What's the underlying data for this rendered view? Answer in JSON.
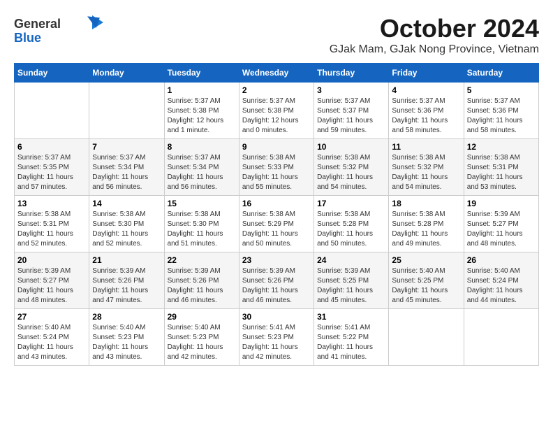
{
  "header": {
    "logo": {
      "general": "General",
      "blue": "Blue"
    },
    "month": "October 2024",
    "location": "GJak Mam, GJak Nong Province, Vietnam"
  },
  "weekdays": [
    "Sunday",
    "Monday",
    "Tuesday",
    "Wednesday",
    "Thursday",
    "Friday",
    "Saturday"
  ],
  "weeks": [
    [
      {
        "day": "",
        "sunrise": "",
        "sunset": "",
        "daylight": ""
      },
      {
        "day": "",
        "sunrise": "",
        "sunset": "",
        "daylight": ""
      },
      {
        "day": "1",
        "sunrise": "Sunrise: 5:37 AM",
        "sunset": "Sunset: 5:38 PM",
        "daylight": "Daylight: 12 hours and 1 minute."
      },
      {
        "day": "2",
        "sunrise": "Sunrise: 5:37 AM",
        "sunset": "Sunset: 5:38 PM",
        "daylight": "Daylight: 12 hours and 0 minutes."
      },
      {
        "day": "3",
        "sunrise": "Sunrise: 5:37 AM",
        "sunset": "Sunset: 5:37 PM",
        "daylight": "Daylight: 11 hours and 59 minutes."
      },
      {
        "day": "4",
        "sunrise": "Sunrise: 5:37 AM",
        "sunset": "Sunset: 5:36 PM",
        "daylight": "Daylight: 11 hours and 58 minutes."
      },
      {
        "day": "5",
        "sunrise": "Sunrise: 5:37 AM",
        "sunset": "Sunset: 5:36 PM",
        "daylight": "Daylight: 11 hours and 58 minutes."
      }
    ],
    [
      {
        "day": "6",
        "sunrise": "Sunrise: 5:37 AM",
        "sunset": "Sunset: 5:35 PM",
        "daylight": "Daylight: 11 hours and 57 minutes."
      },
      {
        "day": "7",
        "sunrise": "Sunrise: 5:37 AM",
        "sunset": "Sunset: 5:34 PM",
        "daylight": "Daylight: 11 hours and 56 minutes."
      },
      {
        "day": "8",
        "sunrise": "Sunrise: 5:37 AM",
        "sunset": "Sunset: 5:34 PM",
        "daylight": "Daylight: 11 hours and 56 minutes."
      },
      {
        "day": "9",
        "sunrise": "Sunrise: 5:38 AM",
        "sunset": "Sunset: 5:33 PM",
        "daylight": "Daylight: 11 hours and 55 minutes."
      },
      {
        "day": "10",
        "sunrise": "Sunrise: 5:38 AM",
        "sunset": "Sunset: 5:32 PM",
        "daylight": "Daylight: 11 hours and 54 minutes."
      },
      {
        "day": "11",
        "sunrise": "Sunrise: 5:38 AM",
        "sunset": "Sunset: 5:32 PM",
        "daylight": "Daylight: 11 hours and 54 minutes."
      },
      {
        "day": "12",
        "sunrise": "Sunrise: 5:38 AM",
        "sunset": "Sunset: 5:31 PM",
        "daylight": "Daylight: 11 hours and 53 minutes."
      }
    ],
    [
      {
        "day": "13",
        "sunrise": "Sunrise: 5:38 AM",
        "sunset": "Sunset: 5:31 PM",
        "daylight": "Daylight: 11 hours and 52 minutes."
      },
      {
        "day": "14",
        "sunrise": "Sunrise: 5:38 AM",
        "sunset": "Sunset: 5:30 PM",
        "daylight": "Daylight: 11 hours and 52 minutes."
      },
      {
        "day": "15",
        "sunrise": "Sunrise: 5:38 AM",
        "sunset": "Sunset: 5:30 PM",
        "daylight": "Daylight: 11 hours and 51 minutes."
      },
      {
        "day": "16",
        "sunrise": "Sunrise: 5:38 AM",
        "sunset": "Sunset: 5:29 PM",
        "daylight": "Daylight: 11 hours and 50 minutes."
      },
      {
        "day": "17",
        "sunrise": "Sunrise: 5:38 AM",
        "sunset": "Sunset: 5:28 PM",
        "daylight": "Daylight: 11 hours and 50 minutes."
      },
      {
        "day": "18",
        "sunrise": "Sunrise: 5:38 AM",
        "sunset": "Sunset: 5:28 PM",
        "daylight": "Daylight: 11 hours and 49 minutes."
      },
      {
        "day": "19",
        "sunrise": "Sunrise: 5:39 AM",
        "sunset": "Sunset: 5:27 PM",
        "daylight": "Daylight: 11 hours and 48 minutes."
      }
    ],
    [
      {
        "day": "20",
        "sunrise": "Sunrise: 5:39 AM",
        "sunset": "Sunset: 5:27 PM",
        "daylight": "Daylight: 11 hours and 48 minutes."
      },
      {
        "day": "21",
        "sunrise": "Sunrise: 5:39 AM",
        "sunset": "Sunset: 5:26 PM",
        "daylight": "Daylight: 11 hours and 47 minutes."
      },
      {
        "day": "22",
        "sunrise": "Sunrise: 5:39 AM",
        "sunset": "Sunset: 5:26 PM",
        "daylight": "Daylight: 11 hours and 46 minutes."
      },
      {
        "day": "23",
        "sunrise": "Sunrise: 5:39 AM",
        "sunset": "Sunset: 5:26 PM",
        "daylight": "Daylight: 11 hours and 46 minutes."
      },
      {
        "day": "24",
        "sunrise": "Sunrise: 5:39 AM",
        "sunset": "Sunset: 5:25 PM",
        "daylight": "Daylight: 11 hours and 45 minutes."
      },
      {
        "day": "25",
        "sunrise": "Sunrise: 5:40 AM",
        "sunset": "Sunset: 5:25 PM",
        "daylight": "Daylight: 11 hours and 45 minutes."
      },
      {
        "day": "26",
        "sunrise": "Sunrise: 5:40 AM",
        "sunset": "Sunset: 5:24 PM",
        "daylight": "Daylight: 11 hours and 44 minutes."
      }
    ],
    [
      {
        "day": "27",
        "sunrise": "Sunrise: 5:40 AM",
        "sunset": "Sunset: 5:24 PM",
        "daylight": "Daylight: 11 hours and 43 minutes."
      },
      {
        "day": "28",
        "sunrise": "Sunrise: 5:40 AM",
        "sunset": "Sunset: 5:23 PM",
        "daylight": "Daylight: 11 hours and 43 minutes."
      },
      {
        "day": "29",
        "sunrise": "Sunrise: 5:40 AM",
        "sunset": "Sunset: 5:23 PM",
        "daylight": "Daylight: 11 hours and 42 minutes."
      },
      {
        "day": "30",
        "sunrise": "Sunrise: 5:41 AM",
        "sunset": "Sunset: 5:23 PM",
        "daylight": "Daylight: 11 hours and 42 minutes."
      },
      {
        "day": "31",
        "sunrise": "Sunrise: 5:41 AM",
        "sunset": "Sunset: 5:22 PM",
        "daylight": "Daylight: 11 hours and 41 minutes."
      },
      {
        "day": "",
        "sunrise": "",
        "sunset": "",
        "daylight": ""
      },
      {
        "day": "",
        "sunrise": "",
        "sunset": "",
        "daylight": ""
      }
    ]
  ]
}
